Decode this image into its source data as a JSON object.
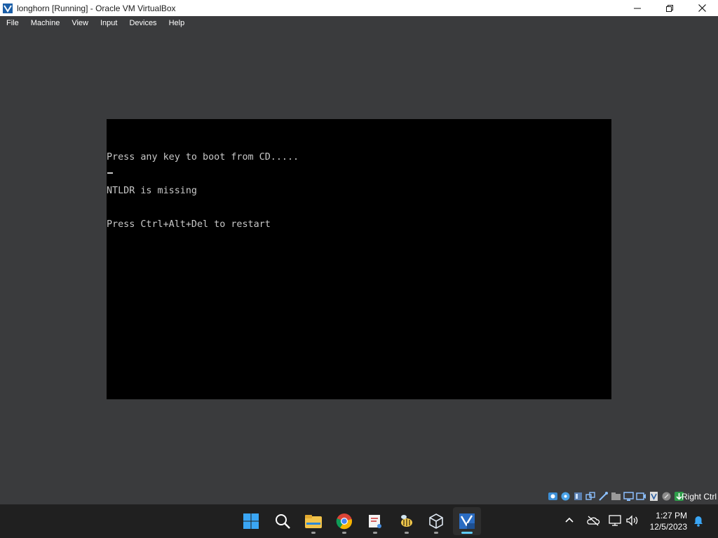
{
  "window": {
    "title": "longhorn [Running] - Oracle VM VirtualBox",
    "icons": {
      "app": "virtualbox-icon",
      "minimize": "minimize-icon",
      "restore": "restore-icon",
      "close": "close-icon"
    }
  },
  "menubar": {
    "items": [
      {
        "label": "File"
      },
      {
        "label": "Machine"
      },
      {
        "label": "View"
      },
      {
        "label": "Input"
      },
      {
        "label": "Devices"
      },
      {
        "label": "Help"
      }
    ]
  },
  "vm_console": {
    "lines": [
      "Press any key to boot from CD.....",
      "NTLDR is missing",
      "Press Ctrl+Alt+Del to restart"
    ],
    "text_color": "#c8c8c8",
    "background": "#000000"
  },
  "statusbar": {
    "icons": [
      "hard-disk-icon",
      "optical-drive-icon",
      "audio-icon",
      "network-icon",
      "usb-icon",
      "shared-folders-icon",
      "display-icon",
      "recording-icon",
      "virtualization-icon",
      "mouse-integration-icon",
      "keyboard-icon"
    ],
    "host_key_label": "Right Ctrl"
  },
  "taskbar": {
    "apps": [
      "start-icon",
      "search-icon",
      "file-explorer-icon",
      "chrome-icon",
      "snipping-tool-icon",
      "bee-app-icon",
      "virtualbox-manager-icon",
      "virtualbox-vm-xp-icon"
    ],
    "tray": {
      "icons": [
        "show-hidden-icons-chevron",
        "onedrive-offline-icon",
        "network-icon",
        "volume-icon",
        "notification-bell-icon"
      ],
      "time": "1:27 PM",
      "date": "12/5/2023"
    }
  },
  "colors": {
    "background": "#3a3b3d",
    "taskbar": "#202020",
    "accent": "#60cdff"
  }
}
